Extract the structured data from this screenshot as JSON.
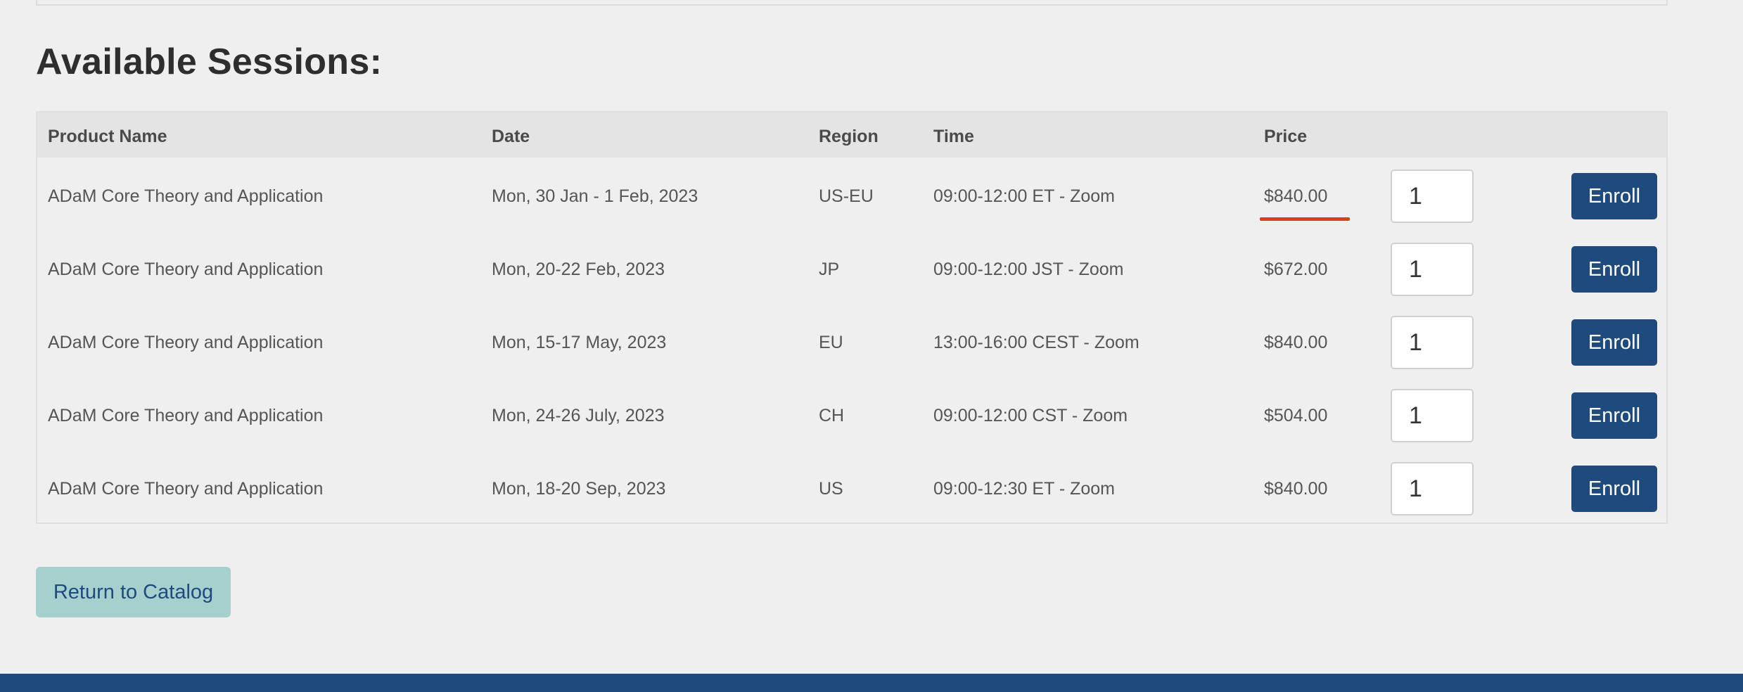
{
  "page": {
    "title": "Available Sessions:"
  },
  "table": {
    "headers": {
      "product_name": "Product Name",
      "date": "Date",
      "region": "Region",
      "time": "Time",
      "price": "Price"
    },
    "rows": [
      {
        "product_name": "ADaM Core Theory and Application",
        "date": "Mon, 30 Jan - 1 Feb, 2023",
        "region": "US-EU",
        "time": "09:00-12:00 ET - Zoom",
        "price": "$840.00",
        "quantity": "1",
        "enroll_label": "Enroll"
      },
      {
        "product_name": "ADaM Core Theory and Application",
        "date": "Mon, 20-22 Feb, 2023",
        "region": "JP",
        "time": "09:00-12:00 JST - Zoom",
        "price": "$672.00",
        "quantity": "1",
        "enroll_label": "Enroll"
      },
      {
        "product_name": "ADaM Core Theory and Application",
        "date": "Mon, 15-17 May, 2023",
        "region": "EU",
        "time": "13:00-16:00 CEST - Zoom",
        "price": "$840.00",
        "quantity": "1",
        "enroll_label": "Enroll"
      },
      {
        "product_name": "ADaM Core Theory and Application",
        "date": "Mon, 24-26 July, 2023",
        "region": "CH",
        "time": "09:00-12:00 CST - Zoom",
        "price": "$504.00",
        "quantity": "1",
        "enroll_label": "Enroll"
      },
      {
        "product_name": "ADaM Core Theory and Application",
        "date": "Mon, 18-20 Sep, 2023",
        "region": "US",
        "time": "09:00-12:30 ET - Zoom",
        "price": "$840.00",
        "quantity": "1",
        "enroll_label": "Enroll"
      }
    ]
  },
  "actions": {
    "return_label": "Return to Catalog"
  },
  "colors": {
    "primary_navy": "#1f4a7e",
    "return_button": "#a5d0ce",
    "accent_underline": "#d9411e",
    "background": "#efefef"
  }
}
